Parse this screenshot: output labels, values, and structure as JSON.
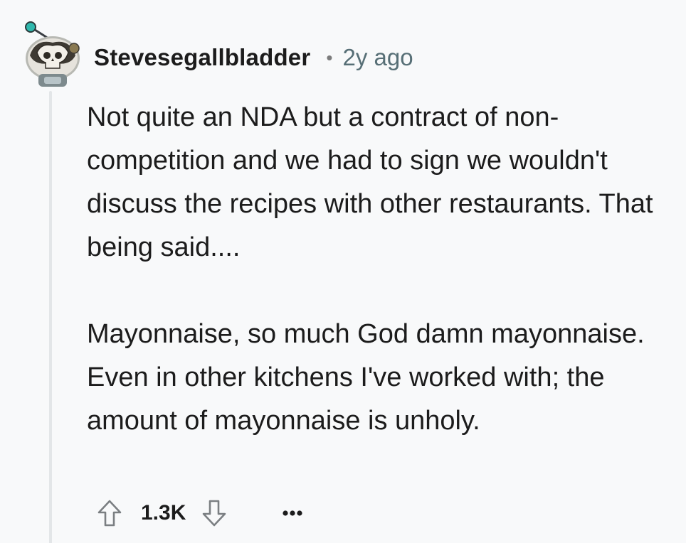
{
  "comment": {
    "author": "Stevesegallbladder",
    "separator": "•",
    "timestamp": "2y ago",
    "paragraphs": [
      "Not quite an NDA but a contract of non-competition and we had to sign we wouldn't discuss the recipes with other restaurants. That being said....",
      "Mayonnaise, so much God damn mayonnaise. Even in other kitchens I've worked with; the amount of mayonnaise is unholy."
    ],
    "score": "1.3K"
  },
  "icons": {
    "avatar": "snoo-avatar-icon",
    "upvote": "upvote-arrow-icon",
    "downvote": "downvote-arrow-icon",
    "more": "more-options-icon"
  },
  "colors": {
    "background": "#f8f9fa",
    "text": "#1c1c1c",
    "muted": "#576f76",
    "thread_line": "#e3e6e8"
  }
}
